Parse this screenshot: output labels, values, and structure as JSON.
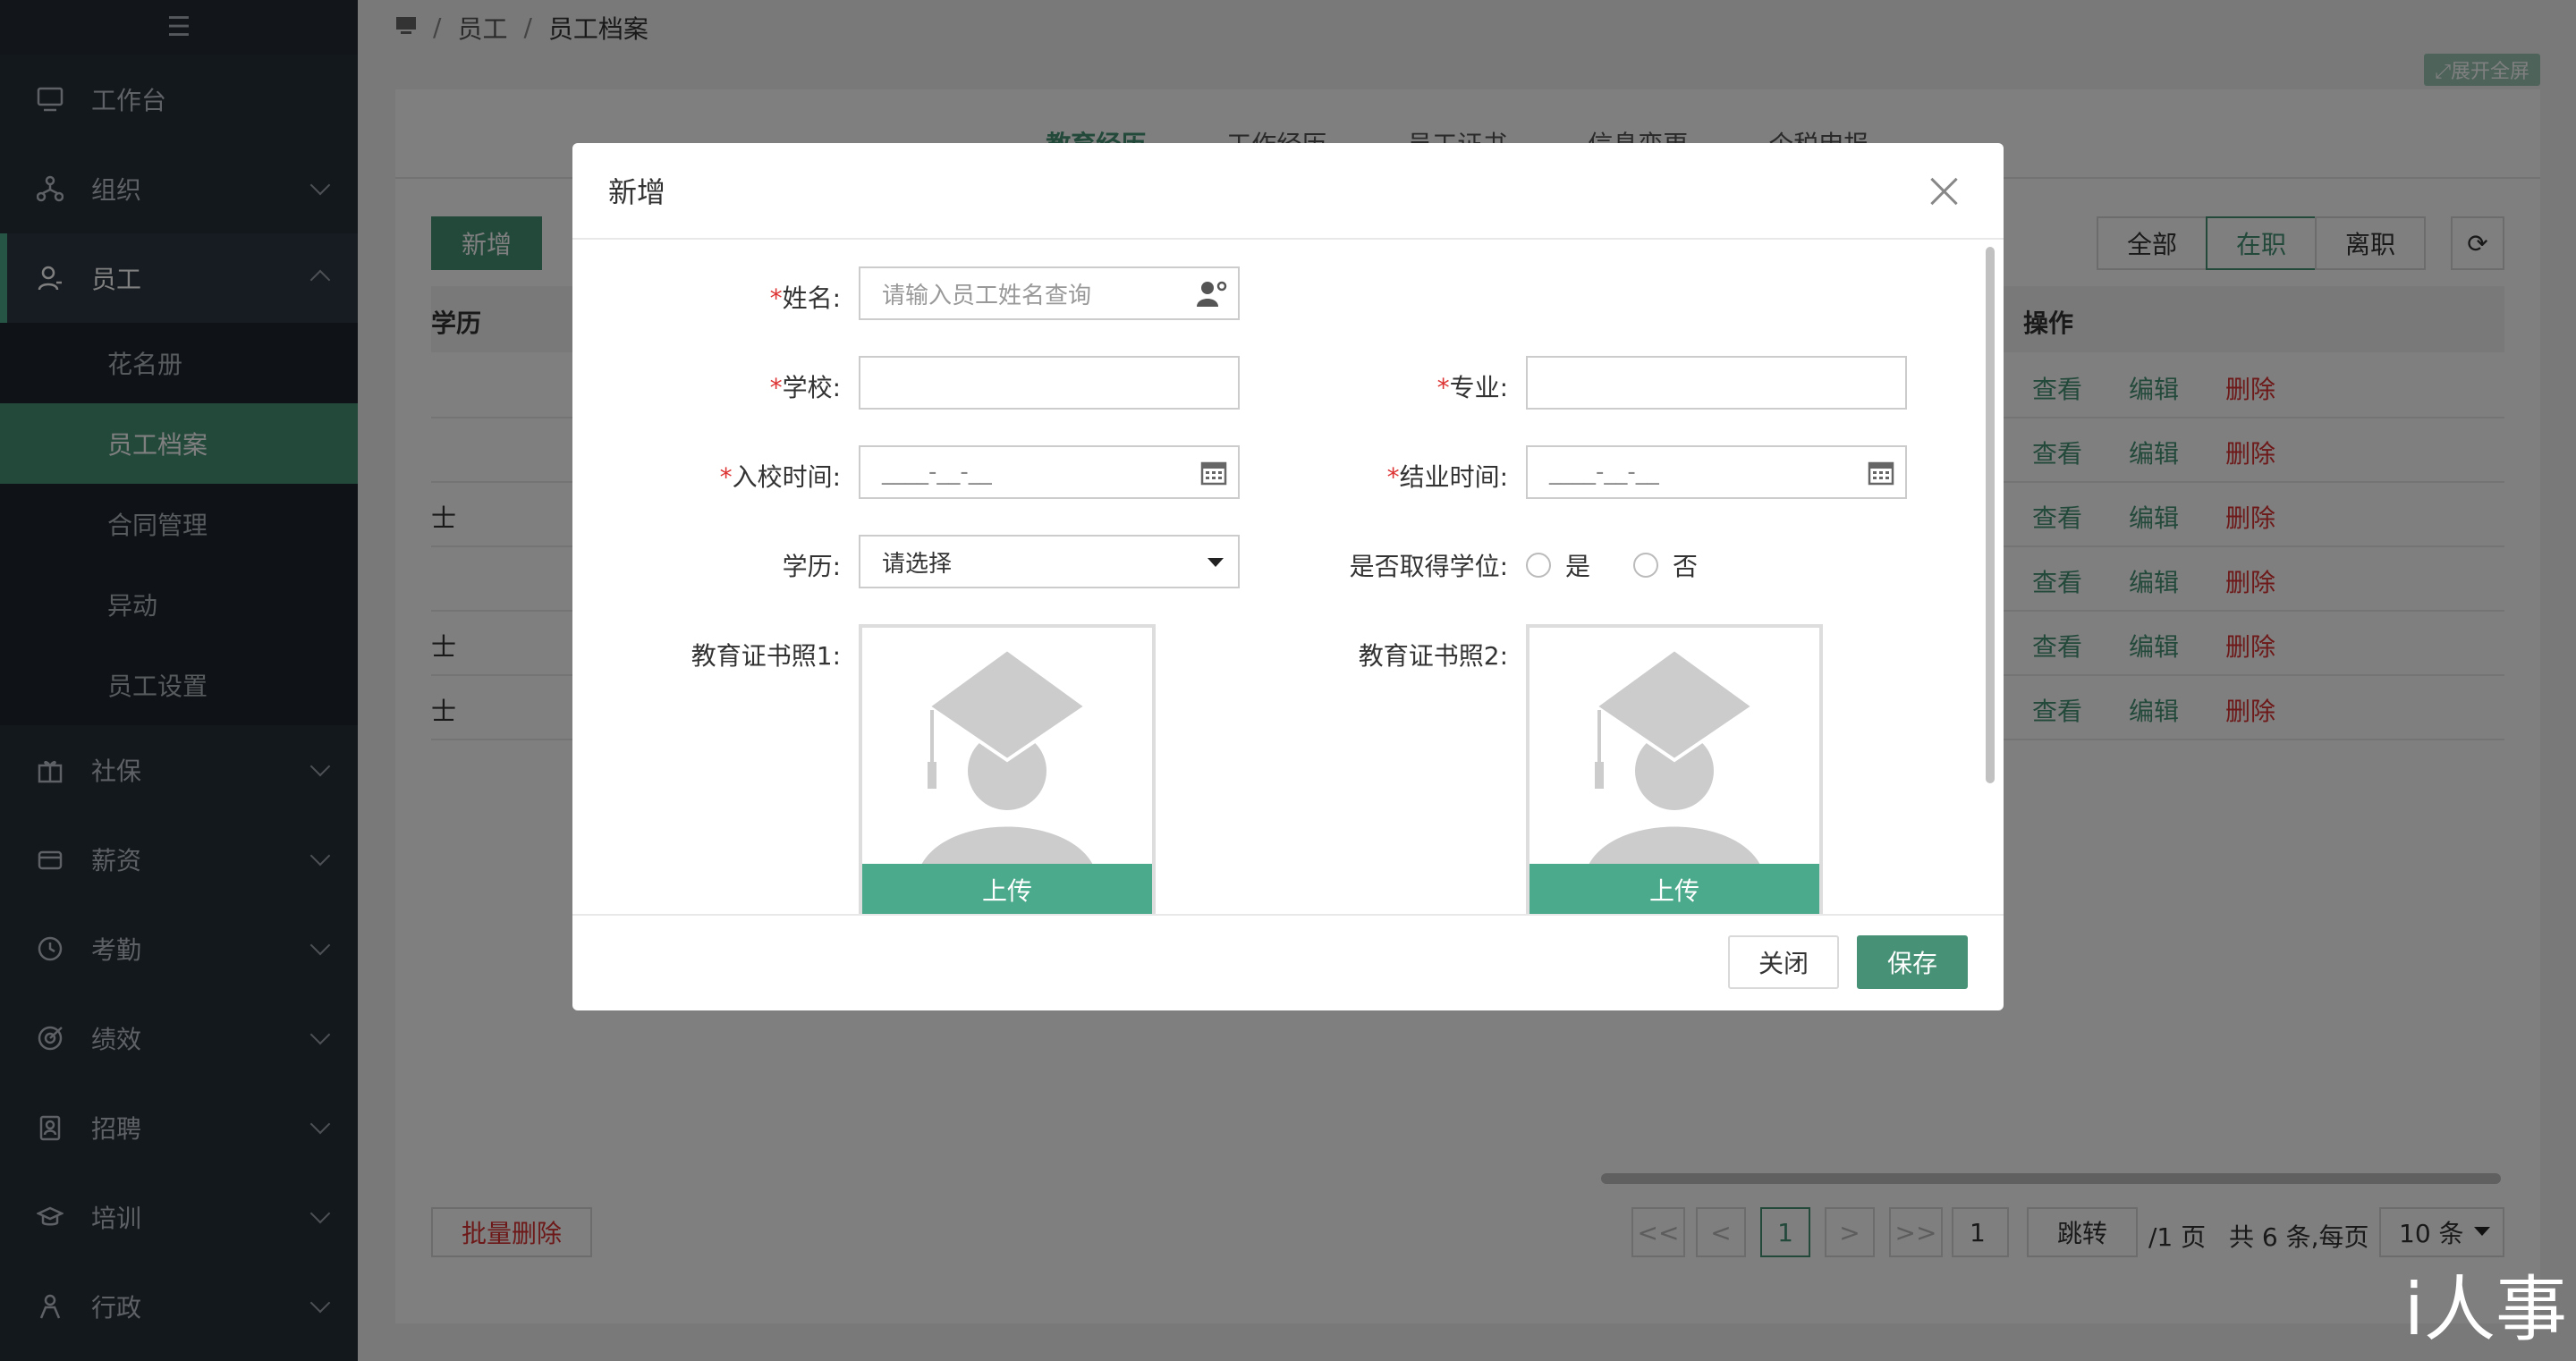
{
  "sidebar": {
    "menu_icon": "hamburger-icon",
    "items": [
      {
        "label": "工作台",
        "icon": "monitor-icon"
      },
      {
        "label": "组织",
        "icon": "org-icon"
      },
      {
        "label": "员工",
        "icon": "user-icon"
      },
      {
        "label": "社保",
        "icon": "gift-icon"
      },
      {
        "label": "薪资",
        "icon": "wallet-icon"
      },
      {
        "label": "考勤",
        "icon": "clock-icon"
      },
      {
        "label": "绩效",
        "icon": "target-icon"
      },
      {
        "label": "招聘",
        "icon": "badge-icon"
      },
      {
        "label": "培训",
        "icon": "cap-icon"
      },
      {
        "label": "行政",
        "icon": "person-icon"
      }
    ],
    "sub_items": [
      "花名册",
      "员工档案",
      "合同管理",
      "异动",
      "员工设置"
    ],
    "active_sub": "员工档案"
  },
  "breadcrumb": {
    "home_icon": "monitor-icon",
    "items": [
      "员工",
      "员工档案"
    ]
  },
  "fullscreen_label": "展开全屏",
  "tabs": [
    "教育经历",
    "工作经历",
    "员工证书",
    "信息变更",
    "个税申报"
  ],
  "toolbar": {
    "add_label": "新增",
    "filters": [
      "全部",
      "在职",
      "离职"
    ],
    "active_filter": "在职"
  },
  "table": {
    "header_left": "学历",
    "header_ops": "操作",
    "rows": [
      {
        "left": ""
      },
      {
        "left": ""
      },
      {
        "left": "士"
      },
      {
        "left": ""
      },
      {
        "left": "士"
      },
      {
        "left": "士"
      }
    ],
    "ops": {
      "view": "查看",
      "edit": "编辑",
      "delete": "删除"
    }
  },
  "footer": {
    "batch_delete": "批量删除",
    "first": "<<",
    "prev": "<",
    "page": "1",
    "next": ">",
    "last": ">>",
    "jump_value": "1",
    "jump_label": "跳转",
    "total_pages": "/1 页",
    "summary": "共 6 条,每页",
    "page_size": "10 条"
  },
  "modal": {
    "title": "新增",
    "fields": {
      "name_label": "姓名:",
      "name_placeholder": "请输入员工姓名查询",
      "school_label": "学校:",
      "major_label": "专业:",
      "start_label": "入校时间:",
      "start_mask": "____-__-__",
      "end_label": "结业时间:",
      "end_mask": "____-__-__",
      "degree_label": "学历:",
      "degree_value": "请选择",
      "got_degree_label": "是否取得学位:",
      "yes": "是",
      "no": "否",
      "cert1_label": "教育证书照1:",
      "cert2_label": "教育证书照2:",
      "upload": "上传"
    },
    "close_label": "关闭",
    "save_label": "保存"
  },
  "watermark": "i人事",
  "colors": {
    "accent": "#479276",
    "danger": "#dd3333",
    "sidebar": "#27313b"
  }
}
